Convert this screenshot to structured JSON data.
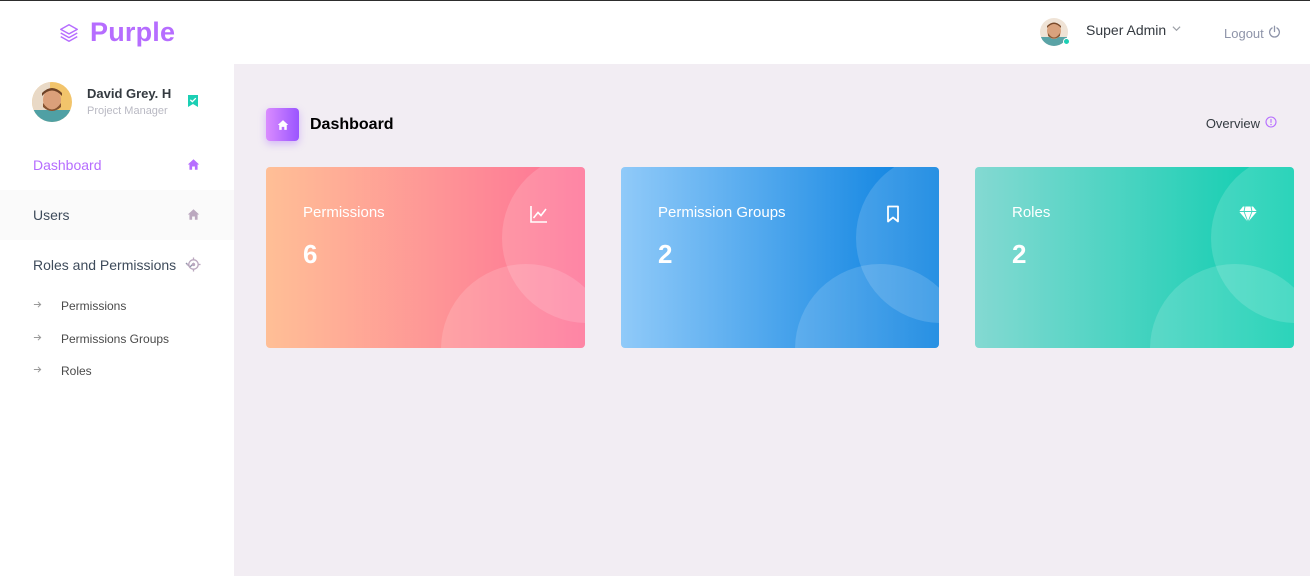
{
  "brand": {
    "name": "Purple",
    "color": "#b66dff"
  },
  "navbar": {
    "user_name": "Super Admin",
    "logout_label": "Logout",
    "user_status_color": "#1bcfb4"
  },
  "sidebar": {
    "profile": {
      "name": "David Grey. H",
      "role": "Project Manager"
    },
    "items": [
      {
        "label": "Dashboard",
        "icon": "home-icon",
        "active": true
      },
      {
        "label": "Users",
        "icon": "home-icon"
      },
      {
        "label": "Roles and Permissions",
        "icon": "crosshairs-icon",
        "expanded": true
      }
    ],
    "subitems": [
      {
        "label": "Permissions"
      },
      {
        "label": "Permissions Groups"
      },
      {
        "label": "Roles"
      }
    ]
  },
  "page": {
    "title": "Dashboard",
    "overview_label": "Overview"
  },
  "cards": [
    {
      "title": "Permissions",
      "value": "6",
      "icon": "chart-line-icon",
      "gradient": [
        "#ffbf96",
        "#fe7096"
      ]
    },
    {
      "title": "Permission Groups",
      "value": "2",
      "icon": "bookmark-icon",
      "gradient": [
        "#90caf9",
        "#047edf"
      ]
    },
    {
      "title": "Roles",
      "value": "2",
      "icon": "diamond-icon",
      "gradient": [
        "#84d9d2",
        "#07cdae"
      ]
    }
  ]
}
